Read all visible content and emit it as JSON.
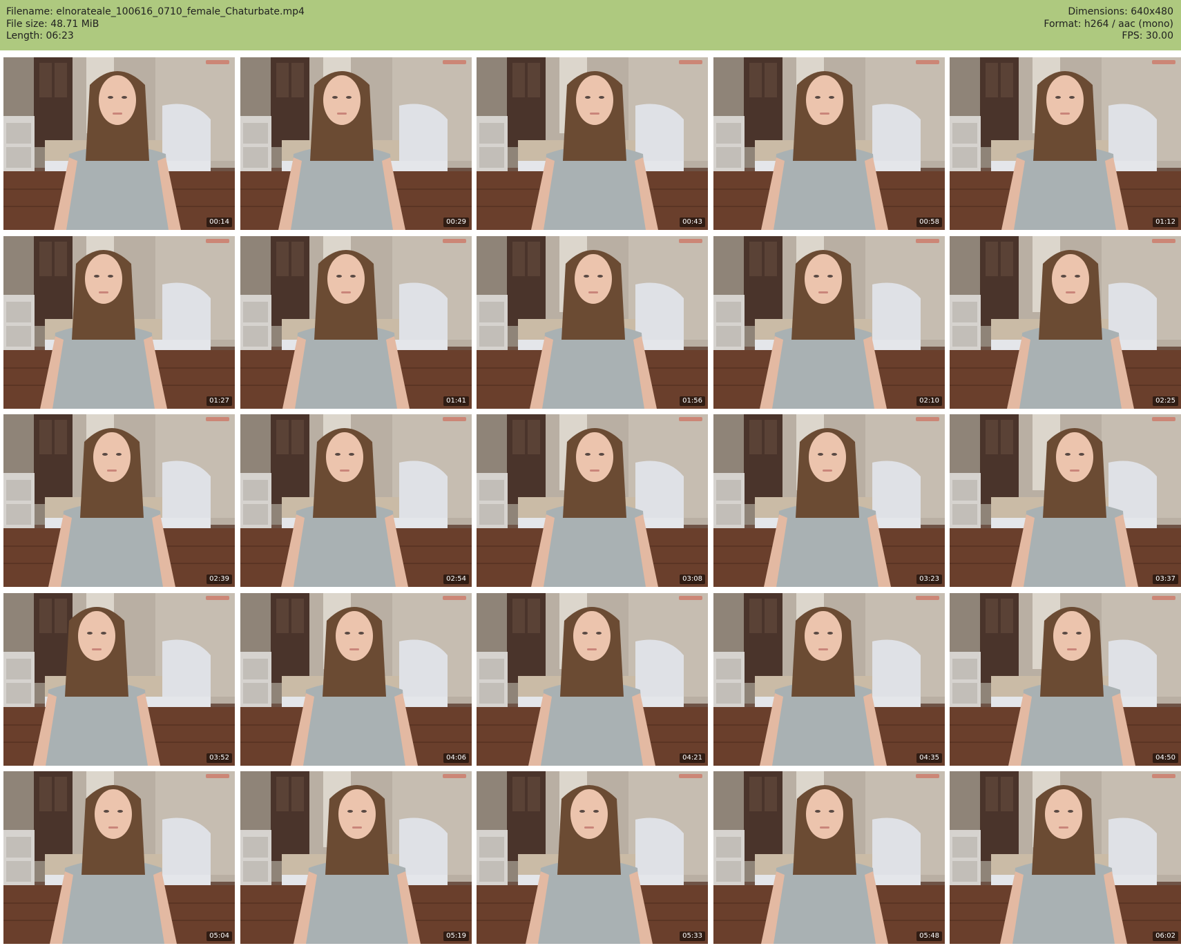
{
  "header": {
    "filename": "Filename: elnorateale_100616_0710_female_Chaturbate.mp4",
    "filesize": "File size: 48.71 MiB",
    "length": "Length: 06:23",
    "dimensions": "Dimensions: 640x480",
    "format": "Format: h264 / aac (mono)",
    "fps": "FPS: 30.00"
  },
  "colors": {
    "header_bg": "#aec97f",
    "page_bg": "#ffffff"
  },
  "thumbnails": [
    {
      "time": "00:14"
    },
    {
      "time": "00:29"
    },
    {
      "time": "00:43"
    },
    {
      "time": "00:58"
    },
    {
      "time": "01:12"
    },
    {
      "time": "01:27"
    },
    {
      "time": "01:41"
    },
    {
      "time": "01:56"
    },
    {
      "time": "02:10"
    },
    {
      "time": "02:25"
    },
    {
      "time": "02:39"
    },
    {
      "time": "02:54"
    },
    {
      "time": "03:08"
    },
    {
      "time": "03:23"
    },
    {
      "time": "03:37"
    },
    {
      "time": "03:52"
    },
    {
      "time": "04:06"
    },
    {
      "time": "04:21"
    },
    {
      "time": "04:35"
    },
    {
      "time": "04:50"
    },
    {
      "time": "05:04"
    },
    {
      "time": "05:19"
    },
    {
      "time": "05:33"
    },
    {
      "time": "05:48"
    },
    {
      "time": "06:02"
    }
  ]
}
